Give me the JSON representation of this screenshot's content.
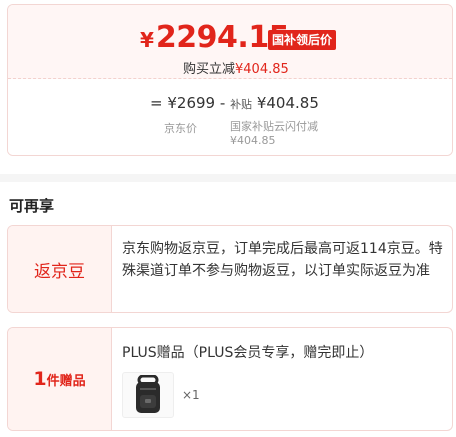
{
  "price": {
    "currency": "¥",
    "amount": "2294.15",
    "badge": "国补领后价",
    "reduce_prefix": "购买立减",
    "reduce_value": "¥404.85"
  },
  "formula": {
    "equals": "=",
    "jd_price": "¥2699",
    "minus": "-",
    "subsidy_small": "补贴",
    "subsidy_value": "¥404.85",
    "jd_price_caption": "京东价",
    "subsidy_caption": "国家补贴云闪付减",
    "subsidy_caption_value": "¥404.85"
  },
  "section_title": "可再享",
  "benefits": {
    "beans": {
      "label": "返京豆",
      "text": "京东购物返京豆，订单完成后最高可返114京豆。特殊渠道订单不参与购物返豆，以订单实际返豆为准"
    },
    "gift": {
      "count": "1",
      "label": "件赠品",
      "title": "PLUS赠品（PLUS会员专享，赠完即止）",
      "qty": "×1",
      "icon": "backpack-icon"
    }
  },
  "colors": {
    "accent": "#e1251b",
    "card_bg": "#fff6f5",
    "border": "#f3d6d3"
  }
}
